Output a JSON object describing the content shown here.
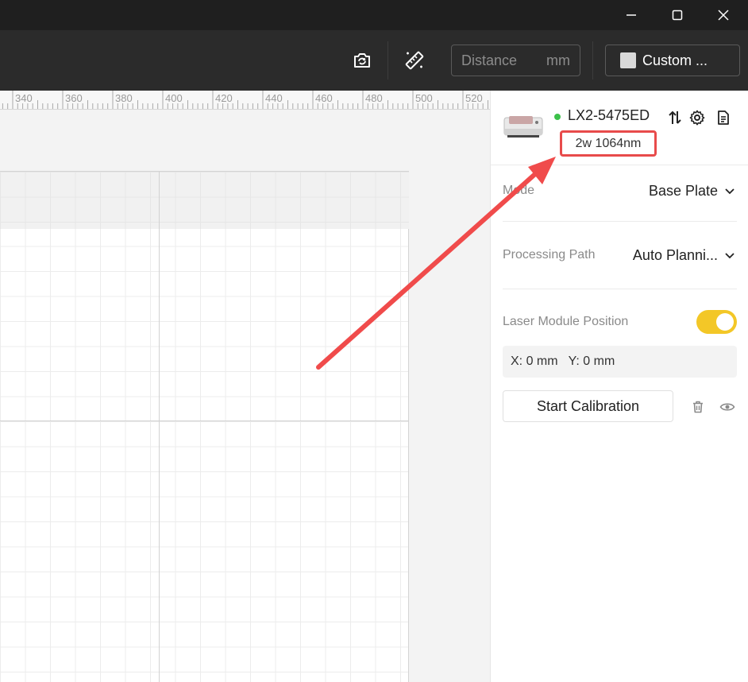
{
  "window": {
    "controls": [
      "minimize",
      "maximize",
      "close"
    ]
  },
  "toolbar": {
    "icons": [
      "camera-capture-icon",
      "measure-ruler-icon"
    ],
    "distance_placeholder": "Distance",
    "distance_unit": "mm",
    "material_label": "Custom ...",
    "material_swatch_color": "#d9d9d9"
  },
  "ruler": {
    "ticks": [
      "340",
      "360",
      "380",
      "400",
      "420",
      "440",
      "460",
      "480",
      "500",
      "520"
    ]
  },
  "device": {
    "name": "LX2-5475ED",
    "status_color": "#3cc14a",
    "laser": "2w 1064nm",
    "icons": [
      "swap-arrows-icon",
      "gear-icon",
      "document-icon"
    ]
  },
  "settings": {
    "mode_label": "Mode",
    "mode_value": "Base Plate",
    "path_label": "Processing Path",
    "path_value": "Auto Planni...",
    "laser_position_label": "Laser Module Position",
    "laser_position_enabled": true,
    "coords": "X: 0 mm   Y: 0 mm",
    "calibration_label": "Start Calibration"
  },
  "colors": {
    "accent_toggle": "#f3c727",
    "annotation_red": "#e84b4b"
  }
}
